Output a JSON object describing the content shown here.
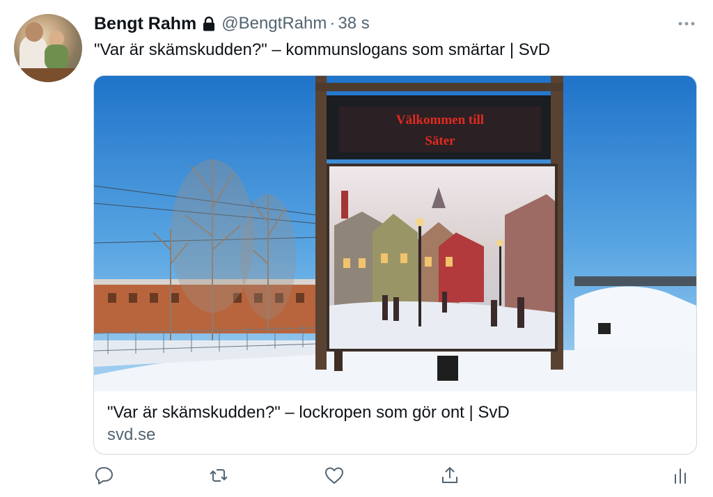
{
  "tweet": {
    "author_name": "Bengt Rahm",
    "handle": "@BengtRahm",
    "separator": "·",
    "time": "38 s",
    "protected_icon": "lock-icon",
    "text": "\"Var är skämskudden?\" – kommunslogans som smärtar | SvD"
  },
  "card": {
    "image_sign_line1": "Välkommen till",
    "image_sign_line2": "Säter",
    "title": "\"Var är skämskudden?\" – lockropen som gör ont | SvD",
    "domain": "svd.se"
  },
  "actions": {
    "icons": [
      "reply-icon",
      "retweet-icon",
      "like-icon",
      "share-icon",
      "analytics-icon"
    ]
  },
  "colors": {
    "text_primary": "#0f1419",
    "text_secondary": "#536471",
    "border": "#cfd9de",
    "sign_led": "#e02b1f"
  }
}
